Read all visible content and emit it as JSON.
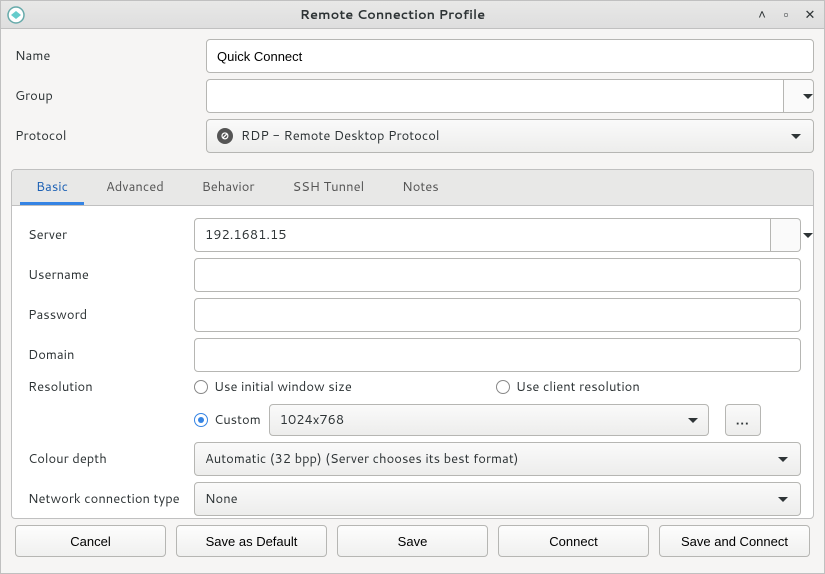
{
  "window": {
    "title": "Remote Connection Profile"
  },
  "labels": {
    "name": "Name",
    "group": "Group",
    "protocol": "Protocol",
    "server": "Server",
    "username": "Username",
    "password": "Password",
    "domain": "Domain",
    "resolution": "Resolution",
    "colour_depth": "Colour depth",
    "network_connection_type": "Network connection type"
  },
  "fields": {
    "name_value": "Quick Connect",
    "group_value": "",
    "protocol_value": "RDP - Remote Desktop Protocol",
    "server_value": "192.1681.15",
    "username_value": "",
    "password_value": "",
    "domain_value": "",
    "custom_resolution_value": "1024x768",
    "colour_depth_value": "Automatic (32 bpp) (Server chooses its best format)",
    "network_type_value": "None"
  },
  "tabs": {
    "basic": "Basic",
    "advanced": "Advanced",
    "behavior": "Behavior",
    "ssh_tunnel": "SSH Tunnel",
    "notes": "Notes"
  },
  "resolution_options": {
    "use_initial": "Use initial window size",
    "use_client": "Use client resolution",
    "custom": "Custom"
  },
  "more_button": "...",
  "buttons": {
    "cancel": "Cancel",
    "save_default": "Save as Default",
    "save": "Save",
    "connect": "Connect",
    "save_connect": "Save and Connect"
  }
}
